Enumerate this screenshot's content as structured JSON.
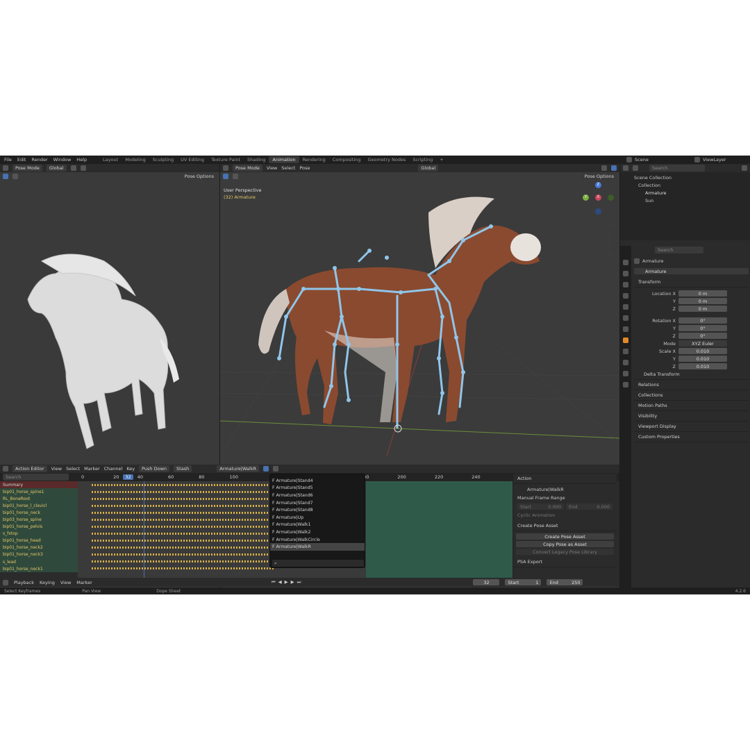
{
  "menu": [
    "File",
    "Edit",
    "Render",
    "Window",
    "Help"
  ],
  "workspaces": [
    "Layout",
    "Modeling",
    "Sculpting",
    "UV Editing",
    "Texture Paint",
    "Shading",
    "Animation",
    "Rendering",
    "Compositing",
    "Geometry Nodes",
    "Scripting",
    "+"
  ],
  "active_workspace": "Animation",
  "scene": "Scene",
  "view_layer": "ViewLayer",
  "left_viewport": {
    "mode": "Pose Mode",
    "orientation": "Global",
    "pose_options": "Pose Options"
  },
  "right_viewport": {
    "mode": "Pose Mode",
    "menus": [
      "View",
      "Select",
      "Pose"
    ],
    "orientation": "Global",
    "pose_options": "Pose Options",
    "perspective": "User Perspective",
    "object_label": "(32) Armature",
    "gizmo": {
      "x": "X",
      "y": "Y",
      "z": "Z"
    }
  },
  "outliner": {
    "search_placeholder": "Search",
    "items": [
      {
        "label": "Scene Collection"
      },
      {
        "label": "Collection"
      },
      {
        "label": "Armature"
      },
      {
        "label": "Sun"
      }
    ]
  },
  "properties": {
    "search_placeholder": "Search",
    "object": "Armature",
    "object_name": "Armature",
    "transform_title": "Transform",
    "location_label": "Location X",
    "location": [
      "0 m",
      "0 m",
      "0 m"
    ],
    "rotation_label": "Rotation X",
    "rotation": [
      "0°",
      "0°",
      "0°"
    ],
    "mode_label": "Mode",
    "mode_value": "XYZ Euler",
    "scale_label": "Scale X",
    "scale": [
      "0.010",
      "0.010",
      "0.010"
    ],
    "axis_y": "Y",
    "axis_z": "Z",
    "sections": [
      "Delta Transform",
      "Relations",
      "Collections",
      "Motion Paths",
      "Visibility",
      "Viewport Display",
      "Custom Properties"
    ]
  },
  "action_editor": {
    "mode": "Action Editor",
    "menus": [
      "View",
      "Select",
      "Marker",
      "Channel",
      "Key"
    ],
    "push_down": "Push Down",
    "stash": "Stash",
    "action_name": "Armature|WalkR",
    "search_placeholder": "Search",
    "frame_numbers": [
      "0",
      "20",
      "32",
      "40",
      "60",
      "80",
      "100",
      "180",
      "200",
      "220",
      "240"
    ],
    "current_frame": "32",
    "channels": [
      "Summary",
      "RL_BoneRoot",
      "bip01_horse_spine1",
      "bip01_horse_l_clavicle",
      "bip01_horse_neck",
      "bip01_horse_spine",
      "bip01_horse_pelvis",
      "s_fxtop",
      "bip01_horse_head",
      "bip01_horse_neck2",
      "bip01_horse_neck3",
      "s_lead",
      "bip01_horse_neck1"
    ],
    "channels_display": [
      "Summary",
      "bip01_horse_spine1",
      "RL_BoneRoot",
      "bip01_horse_l_clavicl",
      "bip01_horse_neck",
      "bip03_horse_spine",
      "bip01_horse_pelvis",
      "s_fxtop",
      "bip01_horse_head",
      "bip01_horse_neck2",
      "bip01_horse_neck3",
      "s_lead",
      "bip01_horse_neck1"
    ]
  },
  "action_dropdown": {
    "items": [
      "F Armature|Stand4",
      "F Armature|Stand5",
      "F Armature|Stand6",
      "F Armature|Stand7",
      "F Armature|Stand8",
      "F Armature|Up",
      "F Armature|Walk1",
      "F Armature|Walk2",
      "F Armature|WalkCircle",
      "F Armature|WalkR"
    ],
    "selected": "F Armature|WalkR"
  },
  "action_panel": {
    "title": "Action",
    "action": "Armature|WalkR",
    "manual_frame_range": "Manual Frame Range",
    "start_label": "Start",
    "start_value": "0.000",
    "end_label": "End",
    "end_value": "0.000",
    "cyclic": "Cyclic Animation",
    "create_pose_title": "Create Pose Asset",
    "create_pose": "Create Pose Asset",
    "copy_pose": "Copy Pose as Asset",
    "convert_legacy": "Convert Legacy Pose Library",
    "psa_export": "PSA Export"
  },
  "timeline": {
    "menus": [
      "Playback",
      "Keying",
      "View",
      "Marker"
    ],
    "frame": "32",
    "start_label": "Start",
    "start": "1",
    "end_label": "End",
    "end": "250"
  },
  "status": {
    "left": "Select Keyframes",
    "middle": "Pan View",
    "right": "Dope Sheet",
    "version": "4.2.6"
  },
  "colors": {
    "accent": "#4772b3",
    "bone": "#8fc6ea",
    "keyframe": "#d8b24a",
    "timeline_green": "#2f5a4a"
  }
}
